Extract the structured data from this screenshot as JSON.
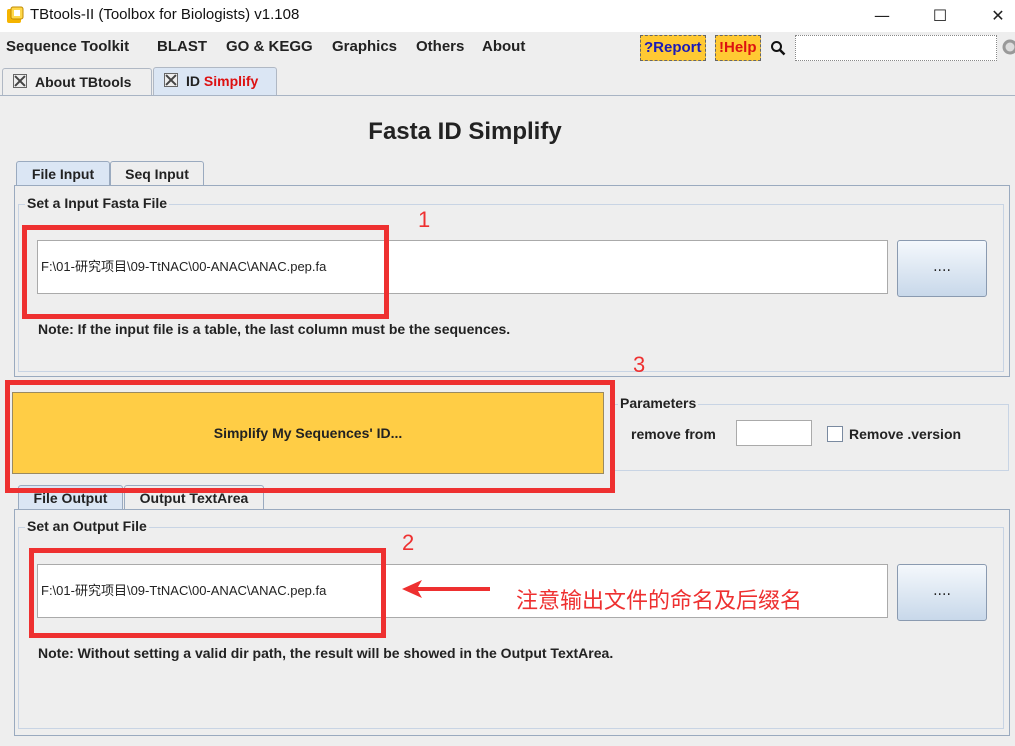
{
  "window": {
    "title": "TBtools-II (Toolbox for Biologists) v1.108",
    "minimize_glyph": "—",
    "maximize_glyph": "☐",
    "close_glyph": "✕"
  },
  "menubar": {
    "items": [
      "Sequence Toolkit",
      "BLAST",
      "GO & KEGG",
      "Graphics",
      "Others",
      "About"
    ],
    "report_label": "?Report",
    "help_label": "!Help",
    "search_placeholder": ""
  },
  "tabs": [
    {
      "label": "About TBtools"
    },
    {
      "label_prefix": "ID",
      "label_suffix": "Simplify"
    }
  ],
  "main": {
    "heading": "Fasta ID Simplify",
    "input_tabs": [
      "File Input",
      "Seq Input"
    ],
    "input_group_title": "Set a Input Fasta File",
    "input_path": "F:\\01-研究项目\\09-TtNAC\\00-ANAC\\ANAC.pep.fa",
    "input_browse_label": "....",
    "input_note": "Note: If the input file is a table, the last column must be the sequences.",
    "simplify_button_label": "Simplify My Sequences' ID...",
    "parameters_title": "Parameters",
    "remove_from_label": "remove from",
    "remove_from_value": "",
    "remove_version_label": "Remove .version",
    "output_tabs": [
      "File Output",
      "Output TextArea"
    ],
    "output_group_title": "Set an Output File",
    "output_path": "F:\\01-研究项目\\09-TtNAC\\00-ANAC\\ANAC.pep.fa",
    "output_browse_label": "....",
    "output_note": "Note: Without setting a valid dir path, the result will be showed in the Output TextArea."
  },
  "annotations": {
    "marker_1": "1",
    "marker_2": "2",
    "marker_3": "3",
    "arrow_note": "注意输出文件的命名及后缀名"
  },
  "colors": {
    "accent_red": "#ee3030",
    "button_yellow": "#ffcd45",
    "help_yellow": "#ffc933",
    "simplify_red": "#dd1111"
  }
}
